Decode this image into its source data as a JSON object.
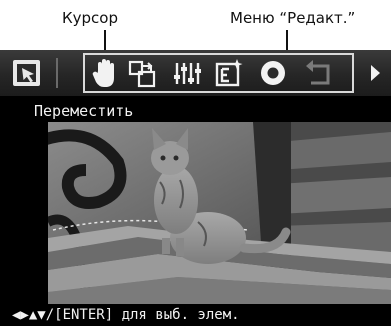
{
  "callouts": {
    "cursor_label": "Курсор",
    "edit_menu_label": "Меню “Редакт.”"
  },
  "toolbar": {
    "items": [
      {
        "icon": "cursor-tool-icon",
        "selected": false
      },
      {
        "icon": "hand-move-icon",
        "selected": true
      },
      {
        "icon": "resize-icon",
        "selected": false
      },
      {
        "icon": "adjust-sliders-icon",
        "selected": false
      },
      {
        "icon": "filter-effect-icon",
        "selected": false
      },
      {
        "icon": "red-eye-icon",
        "selected": false
      },
      {
        "icon": "undo-icon",
        "selected": false
      },
      {
        "icon": "scroll-right-arrow-icon",
        "selected": false
      }
    ],
    "accent_color": "#f2f2f2",
    "bar_color": "#2a2a2a"
  },
  "screen": {
    "title": "Переместить",
    "hint": "◀▶▲▼/[ENTER] для выб. элем."
  }
}
